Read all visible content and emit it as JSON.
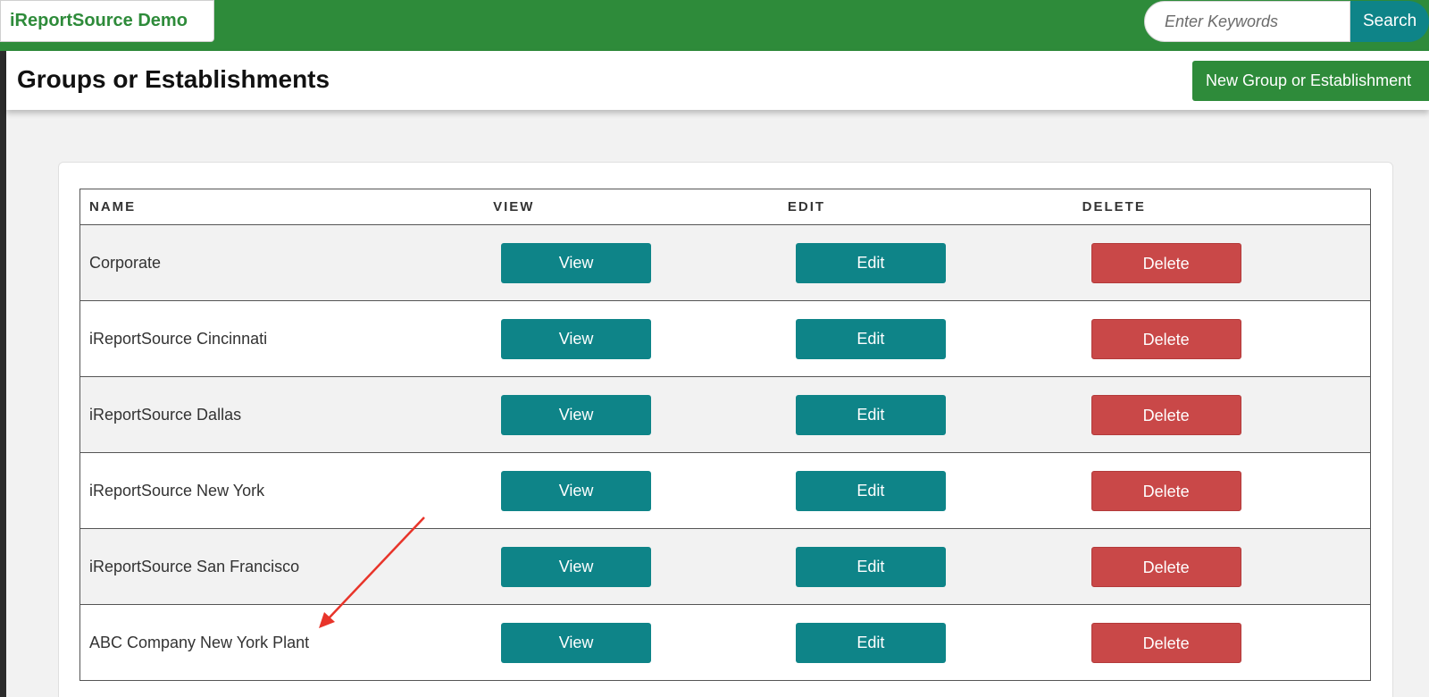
{
  "app": {
    "brand": "iReportSource Demo"
  },
  "search": {
    "placeholder": "Enter Keywords",
    "value": "",
    "button_label": "Search"
  },
  "header": {
    "title": "Groups or Establishments",
    "new_button_label": "New Group or Establishment"
  },
  "table": {
    "columns": [
      "NAME",
      "VIEW",
      "EDIT",
      "DELETE"
    ],
    "rows": [
      {
        "name": "Corporate",
        "view": "View",
        "edit": "Edit",
        "delete": "Delete"
      },
      {
        "name": "iReportSource Cincinnati",
        "view": "View",
        "edit": "Edit",
        "delete": "Delete"
      },
      {
        "name": "iReportSource Dallas",
        "view": "View",
        "edit": "Edit",
        "delete": "Delete"
      },
      {
        "name": "iReportSource New York",
        "view": "View",
        "edit": "Edit",
        "delete": "Delete"
      },
      {
        "name": "iReportSource San Francisco",
        "view": "View",
        "edit": "Edit",
        "delete": "Delete"
      },
      {
        "name": "ABC Company New York Plant",
        "view": "View",
        "edit": "Edit",
        "delete": "Delete"
      }
    ]
  },
  "annotation": {
    "icon": "red-arrow-icon",
    "color": "#e8342a"
  },
  "colors": {
    "brand_green": "#2e8b3a",
    "teal": "#0e8488",
    "danger": "#c94848"
  }
}
